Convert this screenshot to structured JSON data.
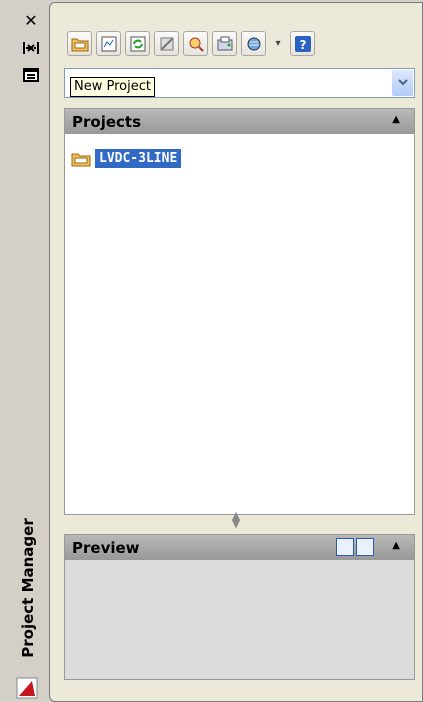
{
  "titlebar": {
    "close_glyph": "✕",
    "autohide_glyph": "⇔",
    "properties_glyph": "▤",
    "title": "Project Manager"
  },
  "toolbar": {
    "tools": [
      "open-project",
      "new-drawing",
      "refresh",
      "project-properties",
      "search",
      "plot",
      "publish",
      "help"
    ]
  },
  "combo": {
    "value": "",
    "arrow": "⌄"
  },
  "tooltip": {
    "text": "New Project"
  },
  "projects": {
    "header": "Projects",
    "collapse_glyph": "▲",
    "items": [
      {
        "label": "LVDC-3LINE"
      }
    ]
  },
  "preview": {
    "header": "Preview",
    "collapse_glyph": "▲"
  },
  "colors": {
    "selection": "#316ac5",
    "header": "#a8a8a8"
  }
}
